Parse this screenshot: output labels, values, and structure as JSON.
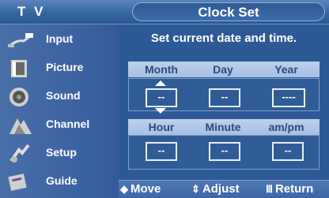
{
  "header": {
    "mode": "T V",
    "title": "Clock Set"
  },
  "sidebar": {
    "items": [
      {
        "label": "Input"
      },
      {
        "label": "Picture"
      },
      {
        "label": "Sound"
      },
      {
        "label": "Channel"
      },
      {
        "label": "Setup"
      },
      {
        "label": "Guide"
      }
    ]
  },
  "panel": {
    "instruction": "Set current date and time.",
    "date": {
      "headers": [
        "Month",
        "Day",
        "Year"
      ],
      "values": [
        "--",
        "--",
        "----"
      ]
    },
    "time": {
      "headers": [
        "Hour",
        "Minute",
        "am/pm"
      ],
      "values": [
        "--",
        "--",
        "--"
      ]
    }
  },
  "footer": {
    "move": {
      "icon": "◆",
      "label": "Move"
    },
    "adjust": {
      "icon": "⇕",
      "label": "Adjust"
    },
    "return": {
      "icon": "Ⅲ",
      "label": "Return"
    }
  }
}
